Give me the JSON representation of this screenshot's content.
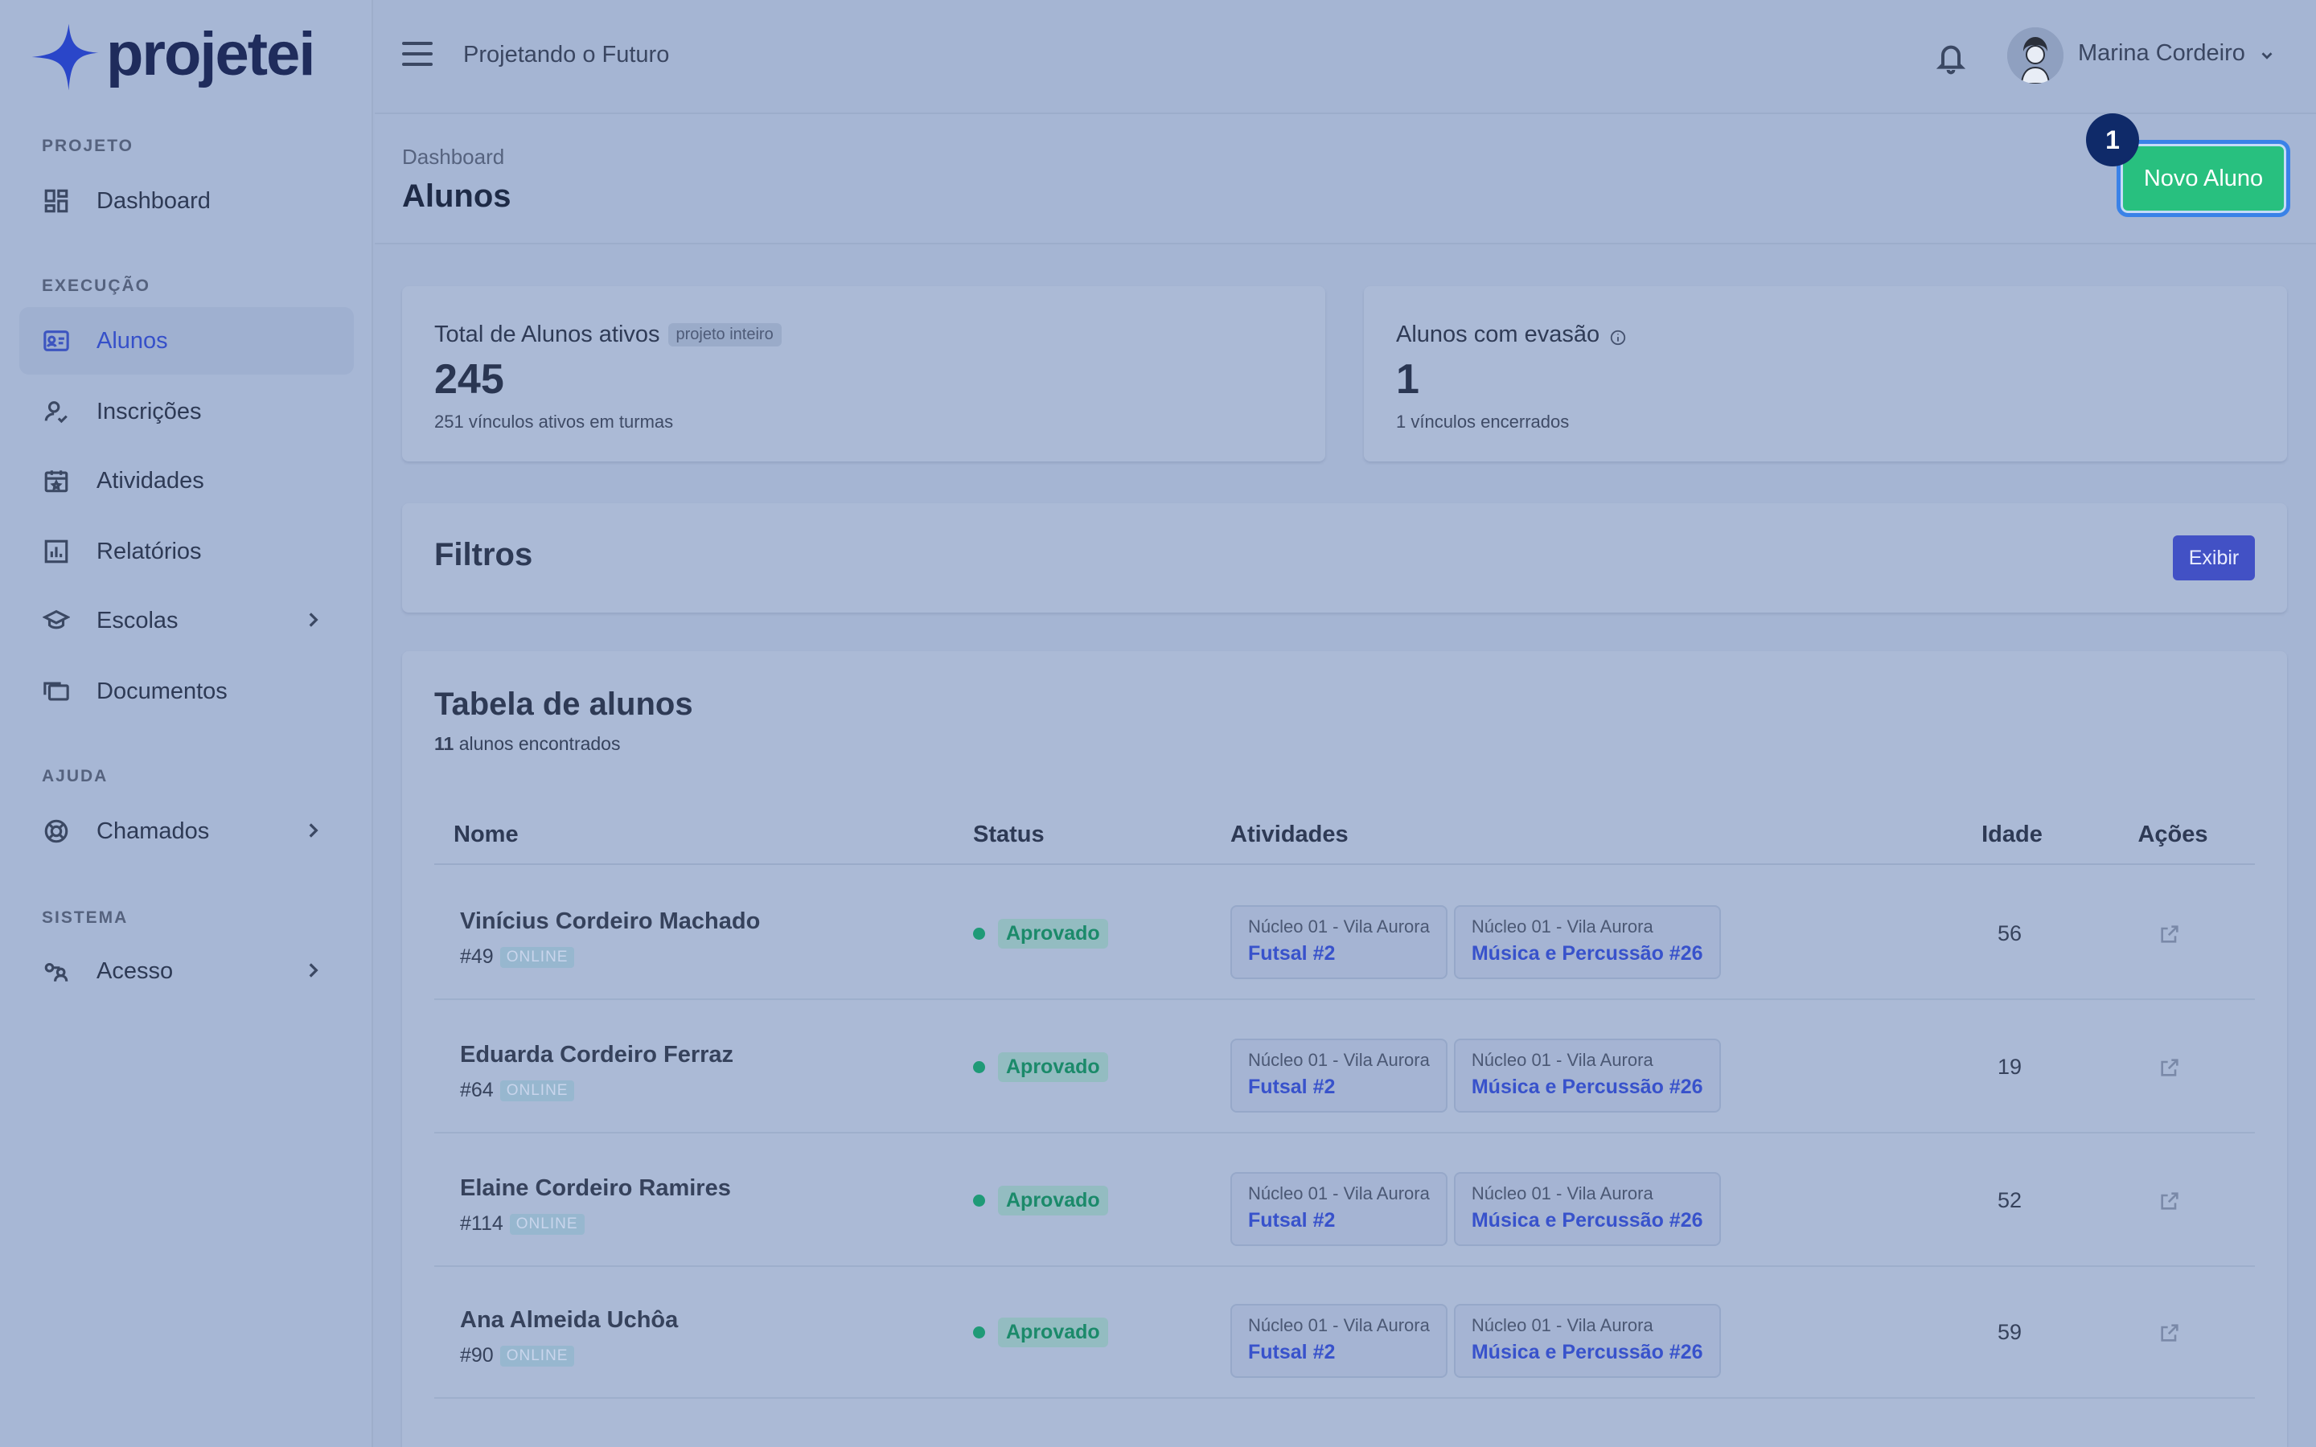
{
  "app": {
    "logo_text": "projetei",
    "project_name": "Projetando o Futuro",
    "user_name": "Marina Cordeiro"
  },
  "sidebar": {
    "sections": [
      {
        "label": "PROJETO"
      },
      {
        "label": "EXECUÇÃO"
      },
      {
        "label": "AJUDA"
      },
      {
        "label": "SISTEMA"
      }
    ],
    "items": [
      {
        "label": "Dashboard",
        "icon": "dashboard-icon"
      },
      {
        "label": "Alunos",
        "icon": "student-card-icon",
        "active": true
      },
      {
        "label": "Inscrições",
        "icon": "user-check-icon"
      },
      {
        "label": "Atividades",
        "icon": "calendar-icon"
      },
      {
        "label": "Relatórios",
        "icon": "chart-icon"
      },
      {
        "label": "Escolas",
        "icon": "school-icon"
      },
      {
        "label": "Documentos",
        "icon": "documents-icon"
      },
      {
        "label": "Chamados",
        "icon": "lifebuoy-icon"
      },
      {
        "label": "Acesso",
        "icon": "key-user-icon"
      }
    ]
  },
  "header": {
    "breadcrumb": "Dashboard",
    "title": "Alunos",
    "new_button": "Novo Aluno",
    "step_badge": "1"
  },
  "stats": {
    "total": {
      "title": "Total de Alunos ativos",
      "pill": "projeto inteiro",
      "value": "245",
      "sub": "251 vínculos ativos em turmas"
    },
    "evasao": {
      "title": "Alunos com evasão",
      "value": "1",
      "sub": "1 vínculos encerrados"
    }
  },
  "filters": {
    "title": "Filtros",
    "button": "Exibir"
  },
  "table": {
    "title": "Tabela de alunos",
    "count": "11",
    "count_suffix": " alunos encontrados",
    "columns": {
      "name": "Nome",
      "status": "Status",
      "activities": "Atividades",
      "age": "Idade",
      "actions": "Ações"
    },
    "rows": [
      {
        "name": "Vinícius Cordeiro Machado",
        "id": "#49",
        "mode": "ONLINE",
        "status": "Aprovado",
        "activities": [
          {
            "place": "Núcleo 01 - Vila Aurora",
            "name": "Futsal #2"
          },
          {
            "place": "Núcleo 01 - Vila Aurora",
            "name": "Música e Percussão #26"
          }
        ],
        "age": "56"
      },
      {
        "name": "Eduarda Cordeiro Ferraz",
        "id": "#64",
        "mode": "ONLINE",
        "status": "Aprovado",
        "activities": [
          {
            "place": "Núcleo 01 - Vila Aurora",
            "name": "Futsal #2"
          },
          {
            "place": "Núcleo 01 - Vila Aurora",
            "name": "Música e Percussão #26"
          }
        ],
        "age": "19"
      },
      {
        "name": "Elaine Cordeiro Ramires",
        "id": "#114",
        "mode": "ONLINE",
        "status": "Aprovado",
        "activities": [
          {
            "place": "Núcleo 01 - Vila Aurora",
            "name": "Futsal #2"
          },
          {
            "place": "Núcleo 01 - Vila Aurora",
            "name": "Música e Percussão #26"
          }
        ],
        "age": "52"
      },
      {
        "name": "Ana Almeida Uchôa",
        "id": "#90",
        "mode": "ONLINE",
        "status": "Aprovado",
        "activities": [
          {
            "place": "Núcleo 01 - Vila Aurora",
            "name": "Futsal #2"
          },
          {
            "place": "Núcleo 01 - Vila Aurora",
            "name": "Música e Percussão #26"
          }
        ],
        "age": "59"
      }
    ]
  }
}
